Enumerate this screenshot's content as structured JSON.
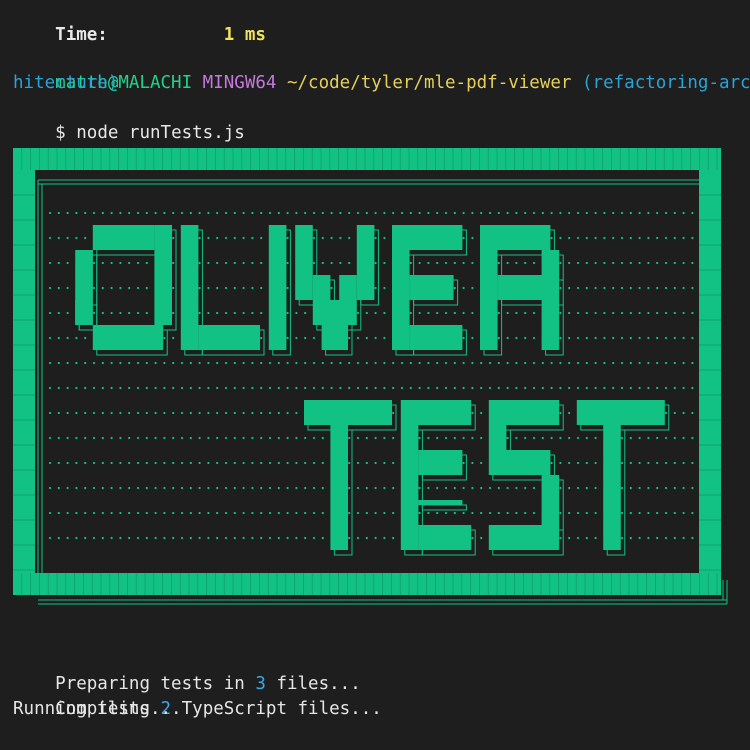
{
  "time": {
    "label": "Time:",
    "value": "1 ms"
  },
  "prompt": {
    "user_host": "matth@MALACHI",
    "shell": "MINGW64",
    "path": "~/code/tyler/mle-pdf-viewer",
    "branch_line1": "(refactoring-arc",
    "branch_line2": "hitecture)",
    "symbol": "$",
    "command": "node runTests.js"
  },
  "banner": {
    "color": "#12c284",
    "line1": "OLIVER",
    "line2": "TEST"
  },
  "output": {
    "preparing_prefix": "Preparing tests in",
    "preparing_count": "3",
    "preparing_suffix": "files...",
    "compiling_prefix": "Compiling",
    "compiling_count": "2",
    "compiling_suffix": "TypeScript files...",
    "running": "Running tests..."
  }
}
